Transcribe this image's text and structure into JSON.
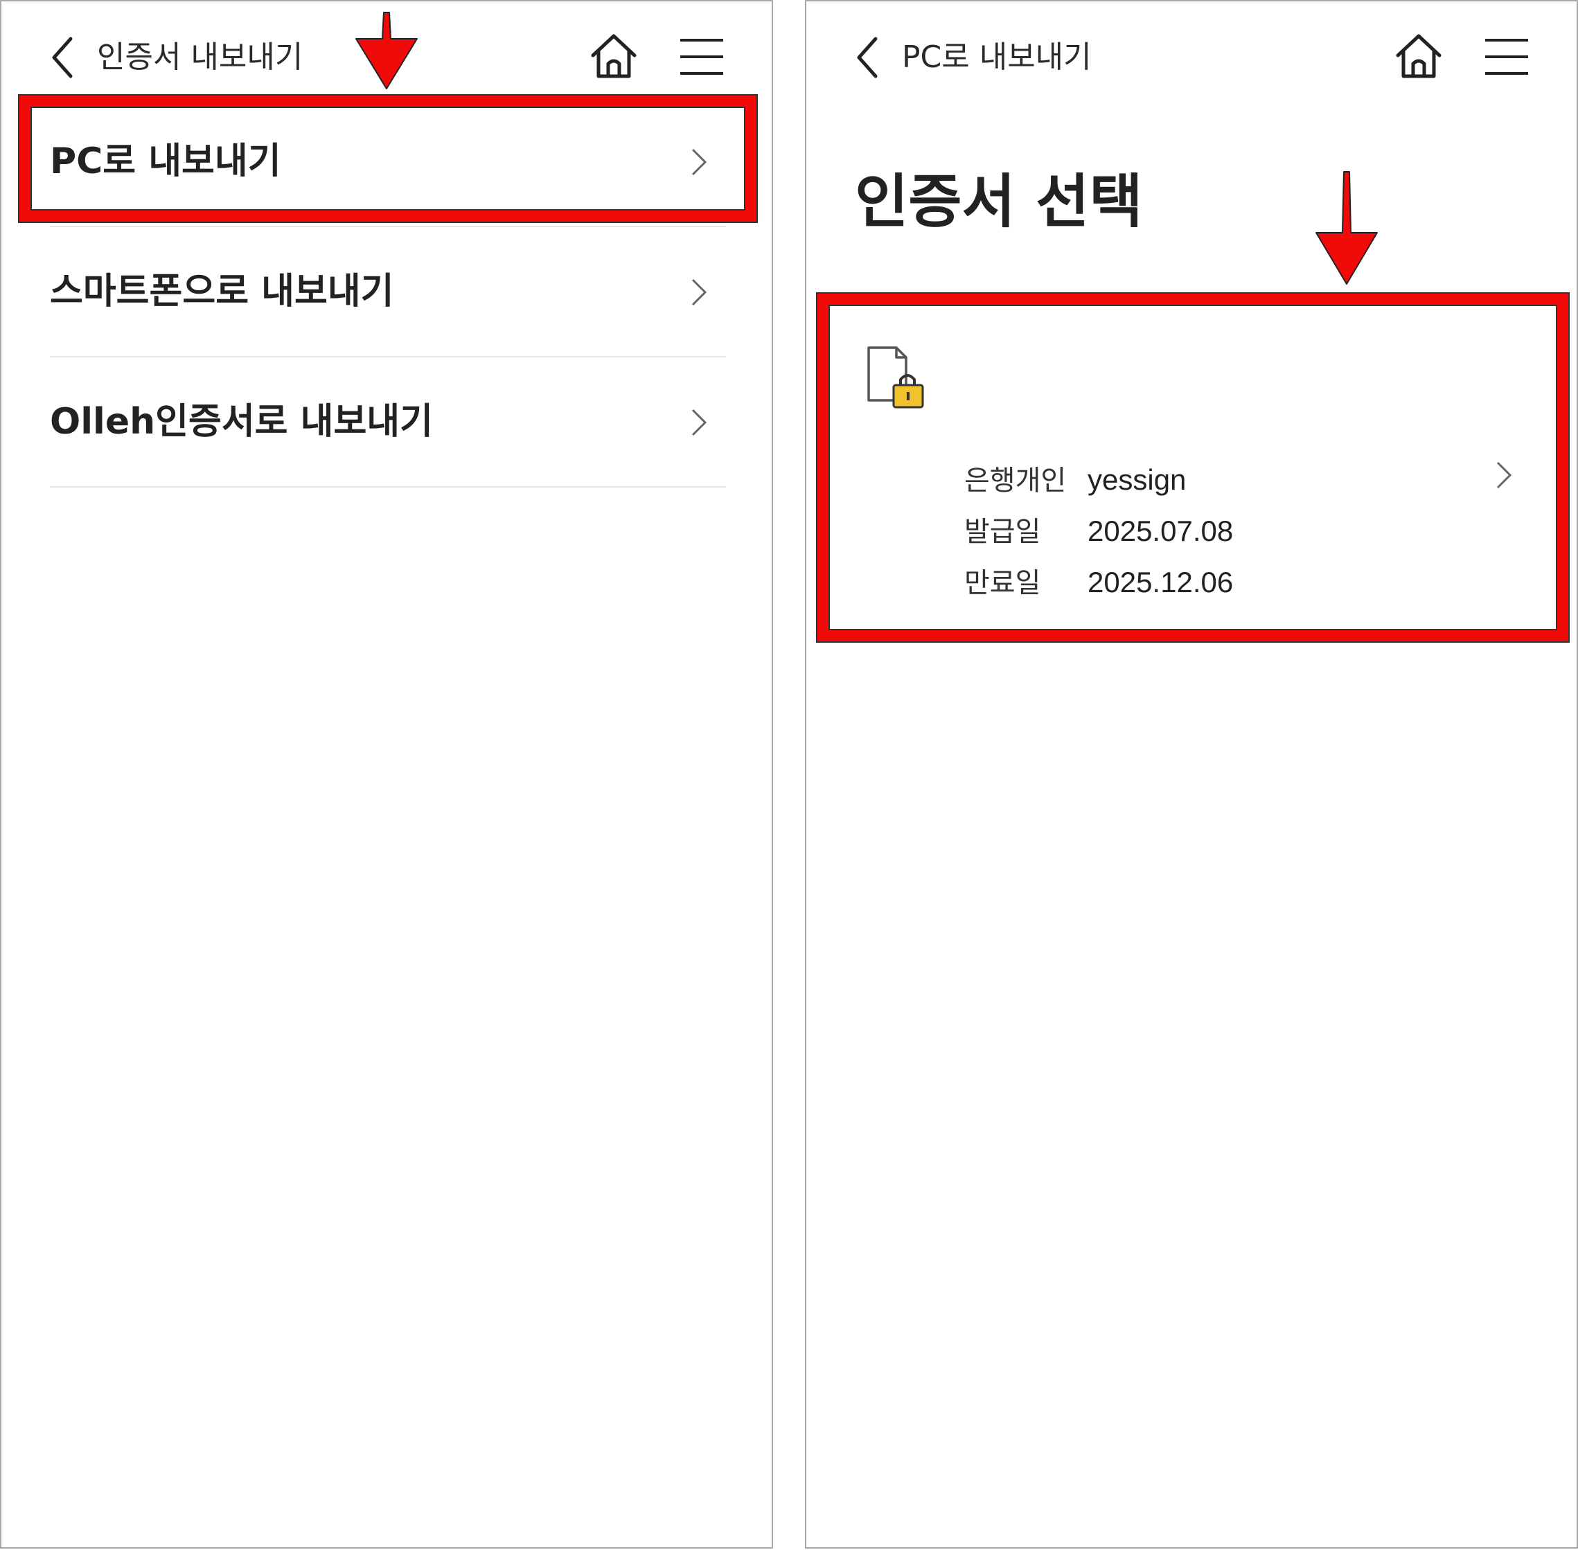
{
  "left_screen": {
    "header": {
      "title": "인증서 내보내기"
    },
    "items": [
      {
        "label": "PC로 내보내기"
      },
      {
        "label": "스마트폰으로 내보내기"
      },
      {
        "label": "Olleh인증서로 내보내기"
      }
    ]
  },
  "right_screen": {
    "header": {
      "title": "PC로 내보내기"
    },
    "page_title": "인증서 선택",
    "certificate": {
      "rows": [
        {
          "key": "은행개인",
          "value": "yessign"
        },
        {
          "key": "발급일",
          "value": "2025.07.08"
        },
        {
          "key": "만료일",
          "value": "2025.12.06"
        }
      ]
    }
  },
  "colors": {
    "highlight": "#f00a0a",
    "lock_body": "#f2c22c",
    "text": "#222222",
    "divider": "#e6e6e6"
  },
  "icons": [
    "back-icon",
    "home-icon",
    "hamburger-menu-icon",
    "chevron-right-icon",
    "certificate-lock-icon",
    "annotation-arrow-icon"
  ]
}
